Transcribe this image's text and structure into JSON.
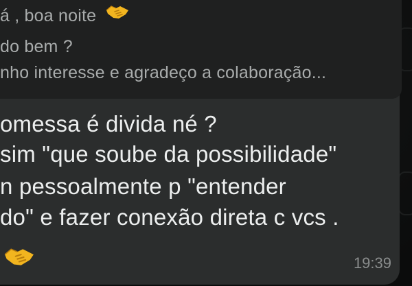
{
  "quoted": {
    "line1": "á , boa noite",
    "line2": "do bem ?",
    "line3": "nho interesse e agradeço a colaboração..."
  },
  "message": {
    "line1": "omessa é divida né ?",
    "line2": "sim \"que soube da possibilidade\"",
    "line3": "n pessoalmente p \"entender",
    "line4": "do\"  e fazer conexão direta c vcs .",
    "emoji": "handshake-icon",
    "time": "19:39"
  },
  "colors": {
    "background": "#0b0c0c",
    "bubble": "#2b2d2d",
    "quoted_bg": "#1f2020",
    "text": "#eceeee",
    "quoted_text": "#a9acac",
    "timestamp": "#8a8d8d",
    "emoji": "#f2b51f"
  }
}
